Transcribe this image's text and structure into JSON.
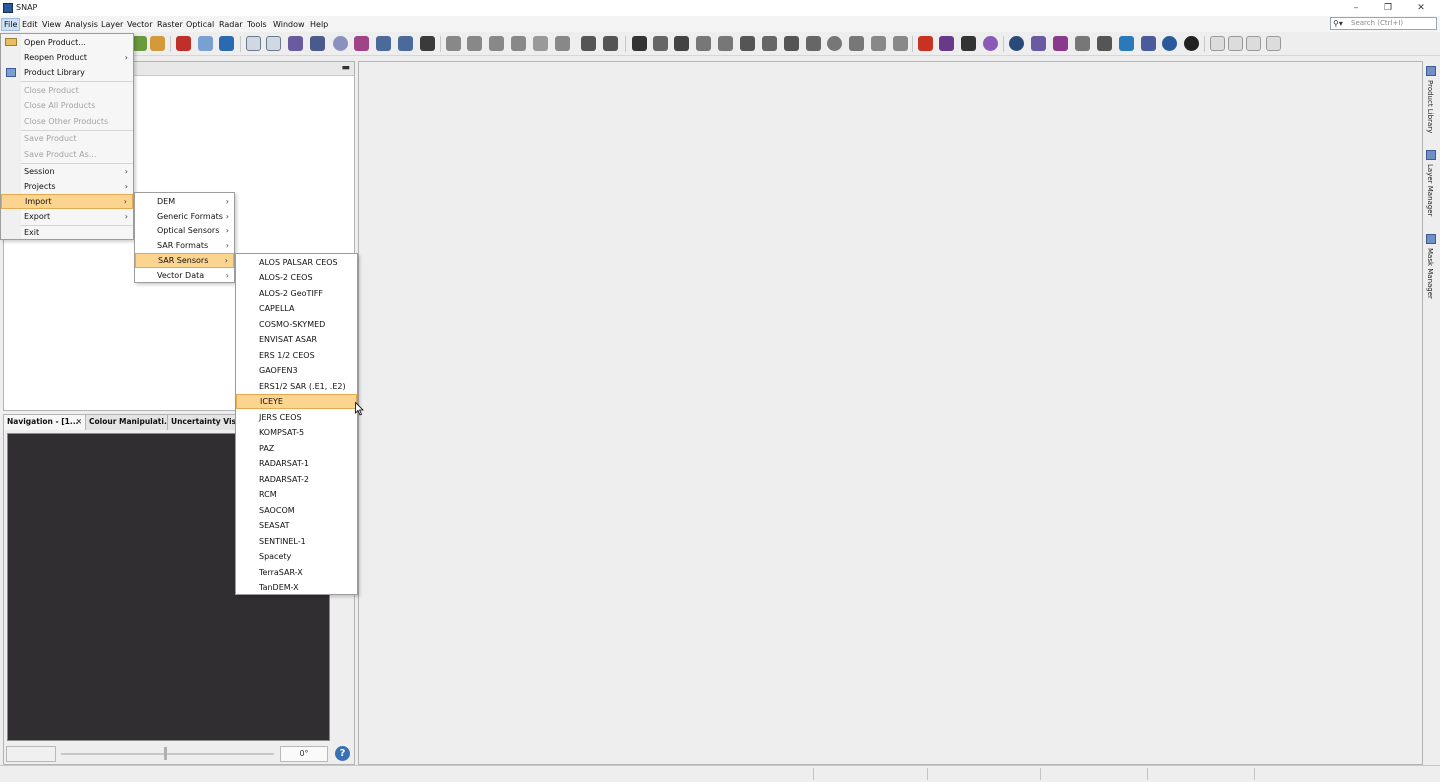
{
  "window": {
    "title": "SNAP",
    "controls": {
      "minimize": "–",
      "restore": "❐",
      "close": "✕"
    }
  },
  "menubar": {
    "items": [
      "File",
      "Edit",
      "View",
      "Analysis",
      "Layer",
      "Vector",
      "Raster",
      "Optical",
      "Radar",
      "Tools",
      "Window",
      "Help"
    ],
    "active": "File"
  },
  "search": {
    "placeholder": "Search (Ctrl+I)"
  },
  "file_menu": {
    "items": [
      {
        "label": "Open Product...",
        "enabled": true,
        "submenu": false
      },
      {
        "label": "Reopen Product",
        "enabled": true,
        "submenu": true
      },
      {
        "label": "Product Library",
        "enabled": true,
        "submenu": false
      },
      {
        "label": "Close Product",
        "enabled": false,
        "submenu": false
      },
      {
        "label": "Close All Products",
        "enabled": false,
        "submenu": false
      },
      {
        "label": "Close Other Products",
        "enabled": false,
        "submenu": false
      },
      {
        "label": "Save Product",
        "enabled": false,
        "submenu": false
      },
      {
        "label": "Save Product As...",
        "enabled": false,
        "submenu": false
      },
      {
        "label": "Session",
        "enabled": true,
        "submenu": true
      },
      {
        "label": "Projects",
        "enabled": true,
        "submenu": true
      },
      {
        "label": "Import",
        "enabled": true,
        "submenu": true,
        "highlighted": true
      },
      {
        "label": "Export",
        "enabled": true,
        "submenu": true
      },
      {
        "label": "Exit",
        "enabled": true,
        "submenu": false
      }
    ]
  },
  "import_menu": {
    "items": [
      "DEM",
      "Generic Formats",
      "Optical Sensors",
      "SAR Formats",
      "SAR Sensors",
      "Vector Data"
    ],
    "highlighted": "SAR Sensors"
  },
  "sar_sensors_menu": {
    "items": [
      "ALOS PALSAR CEOS",
      "ALOS-2 CEOS",
      "ALOS-2 GeoTIFF",
      "CAPELLA",
      "COSMO-SKYMED",
      "ENVISAT ASAR",
      "ERS 1/2 CEOS",
      "GAOFEN3",
      "ERS1/2 SAR (.E1, .E2)",
      "ICEYE",
      "JERS CEOS",
      "KOMPSAT-5",
      "PAZ",
      "RADARSAT-1",
      "RADARSAT-2",
      "RCM",
      "SAOCOM",
      "SEASAT",
      "SENTINEL-1",
      "Spacety",
      "TerraSAR-X",
      "TanDEM-X"
    ],
    "highlighted": "ICEYE"
  },
  "nav_panel": {
    "tabs": [
      "Navigation - [1...",
      "Colour Manipulati...",
      "Uncertainty Visua..."
    ],
    "close_glyph": "✕",
    "rotation": "0°"
  },
  "right_tabs": [
    "Product Library",
    "Layer Manager",
    "Mask Manager"
  ],
  "colors": {
    "highlight": "#fbd490",
    "highlight_border": "#e5a94f",
    "nav_background": "#302e30"
  }
}
